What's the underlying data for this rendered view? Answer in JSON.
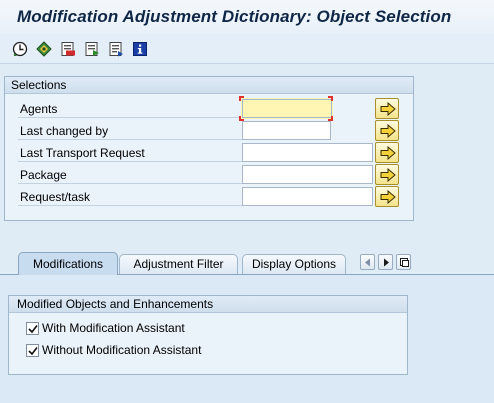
{
  "window": {
    "title": "Modification Adjustment Dictionary: Object Selection"
  },
  "toolbar": {
    "buttons": [
      {
        "icon": "execute-icon"
      },
      {
        "icon": "variant-icon"
      },
      {
        "icon": "delete-icon"
      },
      {
        "icon": "save-variant-icon"
      },
      {
        "icon": "documentation-icon"
      },
      {
        "icon": "info-icon"
      }
    ]
  },
  "selections": {
    "title": "Selections",
    "rows": [
      {
        "label": "Agents",
        "value": ""
      },
      {
        "label": "Last changed by",
        "value": ""
      },
      {
        "label": "Last Transport Request",
        "value": ""
      },
      {
        "label": "Package",
        "value": ""
      },
      {
        "label": "Request/task",
        "value": ""
      }
    ]
  },
  "tabs": [
    {
      "label": "Modifications",
      "active": true
    },
    {
      "label": "Adjustment Filter",
      "active": false
    },
    {
      "label": "Display Options",
      "active": false
    }
  ],
  "modifications_panel": {
    "group_title": "Modified Objects and Enhancements",
    "checkboxes": [
      {
        "label": "With Modification Assistant",
        "checked": true
      },
      {
        "label": "Without Modification Assistant",
        "checked": true
      }
    ]
  },
  "colors": {
    "background": "#dfebf5",
    "title_text": "#0e2746",
    "focused_input": "#fff6b4",
    "arrow_button": "#f4e38a"
  }
}
